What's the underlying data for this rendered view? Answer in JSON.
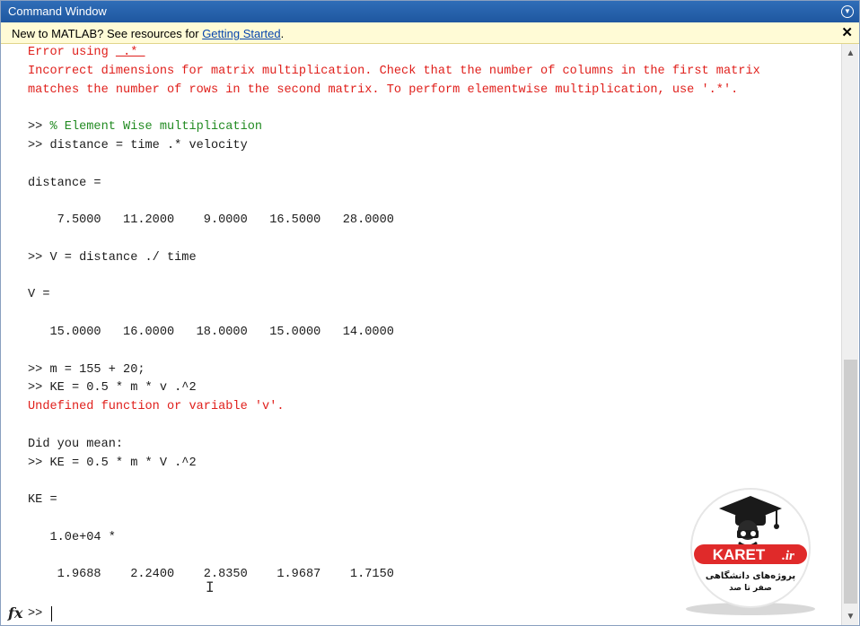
{
  "window": {
    "title": "Command Window"
  },
  "infobar": {
    "message_prefix": "New to MATLAB? See resources for ",
    "link_text": "Getting Started",
    "message_suffix": "."
  },
  "lines": [
    {
      "kind": "err-head",
      "pre": "Error using ",
      "link": " .* "
    },
    {
      "kind": "err",
      "text": "Incorrect dimensions for matrix multiplication. Check that the number of columns in the first matrix"
    },
    {
      "kind": "err",
      "text": "matches the number of rows in the second matrix. To perform elementwise multiplication, use '.*'."
    },
    {
      "kind": "blank",
      "text": ""
    },
    {
      "kind": "cmt",
      "prompt": ">> ",
      "text": "% Element Wise multiplication"
    },
    {
      "kind": "txt",
      "text": ">> distance = time .* velocity"
    },
    {
      "kind": "blank",
      "text": ""
    },
    {
      "kind": "txt",
      "text": "distance ="
    },
    {
      "kind": "blank",
      "text": ""
    },
    {
      "kind": "txt",
      "text": "    7.5000   11.2000    9.0000   16.5000   28.0000"
    },
    {
      "kind": "blank",
      "text": ""
    },
    {
      "kind": "txt",
      "text": ">> V = distance ./ time"
    },
    {
      "kind": "blank",
      "text": ""
    },
    {
      "kind": "txt",
      "text": "V ="
    },
    {
      "kind": "blank",
      "text": ""
    },
    {
      "kind": "txt",
      "text": "   15.0000   16.0000   18.0000   15.0000   14.0000"
    },
    {
      "kind": "blank",
      "text": ""
    },
    {
      "kind": "txt",
      "text": ">> m = 155 + 20;"
    },
    {
      "kind": "txt",
      "text": ">> KE = 0.5 * m * v .^2"
    },
    {
      "kind": "err",
      "text": "Undefined function or variable 'v'."
    },
    {
      "kind": "blank",
      "text": ""
    },
    {
      "kind": "txt",
      "text": "Did you mean:"
    },
    {
      "kind": "txt",
      "text": ">> KE = 0.5 * m * V .^2"
    },
    {
      "kind": "blank",
      "text": ""
    },
    {
      "kind": "txt",
      "text": "KE ="
    },
    {
      "kind": "blank",
      "text": ""
    },
    {
      "kind": "txt",
      "text": "   1.0e+04 *"
    },
    {
      "kind": "blank",
      "text": ""
    },
    {
      "kind": "txt",
      "text": "    1.9688    2.2400    2.8350    1.9687    1.7150"
    }
  ],
  "prompt": {
    "fx": "fx",
    "symbol": ">>"
  },
  "logo": {
    "brand": "KARET",
    "suffix": ".ir",
    "tagline_line1": "پروژه‌های دانشگاهی",
    "tagline_line2": "صفر تا صد"
  },
  "colors": {
    "error": "#e0201c",
    "comment": "#228b22",
    "title_bar": "#2467b0",
    "info_bar": "#fffbd6",
    "logo_red": "#e02a2a"
  }
}
